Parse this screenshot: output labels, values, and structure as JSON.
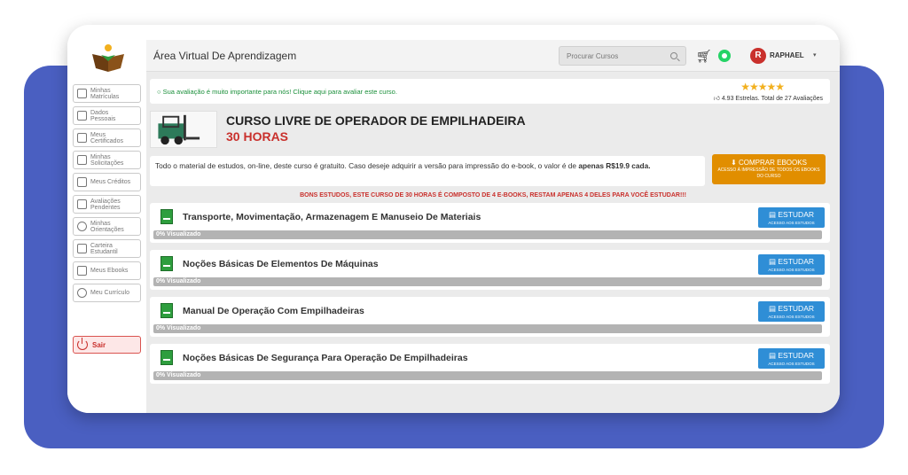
{
  "header": {
    "title": "Área Virtual De Aprendizagem",
    "search_placeholder": "Procurar Cursos",
    "user_initial": "R",
    "user_name": "RAPHAEL",
    "caret": "▾"
  },
  "sidebar": {
    "items": [
      {
        "label": "Minhas Matrículas",
        "icon": "calendar-icon"
      },
      {
        "label": "Dados Pessoais",
        "icon": "id-card-icon"
      },
      {
        "label": "Meus Certificados",
        "icon": "certificate-icon"
      },
      {
        "label": "Minhas Solicitações",
        "icon": "cart-icon"
      },
      {
        "label": "Meus Créditos",
        "icon": "credits-icon"
      },
      {
        "label": "Avaliações Pendentes",
        "icon": "list-icon"
      },
      {
        "label": "Minhas Orientações",
        "icon": "lightbulb-icon"
      },
      {
        "label": "Carteira Estudantil",
        "icon": "wallet-icon"
      },
      {
        "label": "Meus Ebooks",
        "icon": "ebook-icon"
      },
      {
        "label": "Meu Currículo",
        "icon": "user-icon"
      }
    ],
    "logout_label": "Sair"
  },
  "evaluation": {
    "message": "Sua avaliação é muito importante para nós! Clique aqui para avaliar este curso.",
    "stars": "★★★★★",
    "rating_text": "4.93 Estrelas. Total de 27 Avaliações",
    "rating_value": 4.93
  },
  "course": {
    "title": "CURSO LIVRE DE OPERADOR DE EMPILHADEIRA",
    "hours": "30 HORAS"
  },
  "info": {
    "text": "Todo o material de estudos, on-line, deste curso é gratuito. Caso deseje adquirir a versão para impressão do e-book, o valor é de ",
    "price_text": "apenas R$19.9 cada."
  },
  "buy_button": {
    "label": "COMPRAR EBOOKS",
    "sublabel": "ACESSO À IMPRESSÃO DE TODOS OS EBOOKS DO CURSO"
  },
  "notice": "BONS ESTUDOS, ESTE CURSO DE 30 HORAS É COMPOSTO DE 4 E-BOOKS, RESTAM APENAS 4 DELES PARA VOCÊ ESTUDAR!!!",
  "ebooks": [
    {
      "title": "Transporte, Movimentação, Armazenagem E Manuseio De Materiais",
      "progress_label": "0% Visualizado",
      "progress": 0
    },
    {
      "title": "Noções Básicas De Elementos De Máquinas",
      "progress_label": "0% Visualizado",
      "progress": 0
    },
    {
      "title": "Manual De Operação Com Empilhadeiras",
      "progress_label": "0% Visualizado",
      "progress": 0
    },
    {
      "title": "Noções Básicas De Segurança Para Operação De Empilhadeiras",
      "progress_label": "0% Visualizado",
      "progress": 0
    }
  ],
  "study_button": {
    "label": "ESTUDAR",
    "sublabel": "ACESSO AOS ESTUDOS"
  }
}
